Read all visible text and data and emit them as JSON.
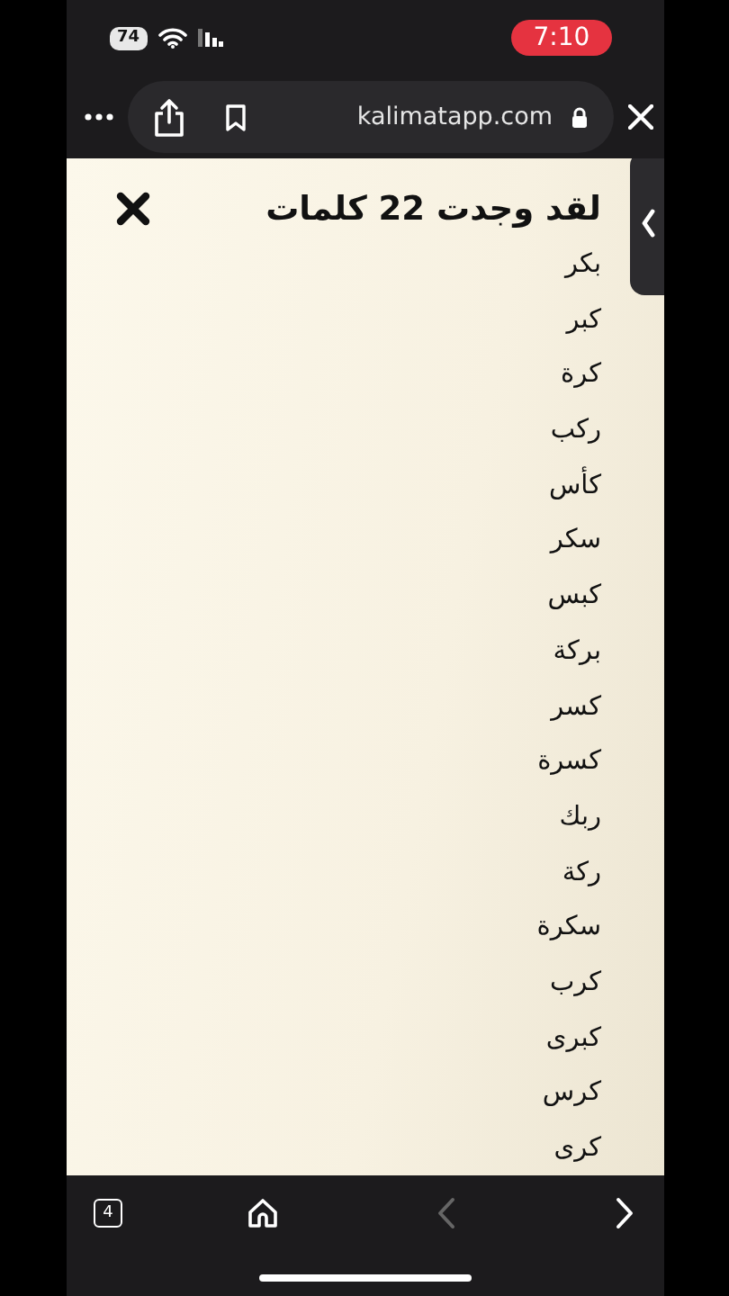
{
  "status_bar": {
    "battery": "74",
    "time": "7:10"
  },
  "browser_bar": {
    "url": "kalimatapp.com"
  },
  "panel": {
    "title": "لقد وجدت 22 كلمات",
    "words": [
      "بكر",
      "كبر",
      "كرة",
      "ركب",
      "كأس",
      "سكر",
      "كبس",
      "بركة",
      "كسر",
      "كسرة",
      "ربك",
      "ركة",
      "سكرة",
      "كرب",
      "كبرى",
      "كرس",
      "كرى"
    ]
  },
  "toolbar": {
    "tab_count": "4",
    "back_disabled": true,
    "forward_disabled": false
  }
}
